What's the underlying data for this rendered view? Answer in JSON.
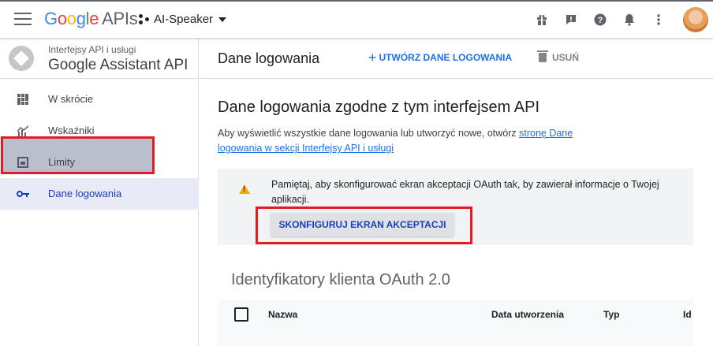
{
  "header": {
    "logo_google": [
      "G",
      "o",
      "o",
      "g",
      "l",
      "e"
    ],
    "logo_apis": "APIs",
    "project_name": "AI-Speaker",
    "icons": [
      "gift-icon",
      "feedback-icon",
      "help-icon",
      "notifications-icon",
      "more-vert-icon",
      "avatar"
    ]
  },
  "sidebar": {
    "api_subtitle": "Interfejsy API i usługi",
    "api_name": "Google Assistant API",
    "items": [
      {
        "label": "W skrócie",
        "icon": "dashboard-icon"
      },
      {
        "label": "Wskaźniki",
        "icon": "metrics-icon"
      },
      {
        "label": "Limity",
        "icon": "quotas-icon"
      },
      {
        "label": "Dane logowania",
        "icon": "key-icon",
        "active": true
      }
    ]
  },
  "action_bar": {
    "title": "Dane logowania",
    "create_label": "UTWÓRZ DANE LOGOWANIA",
    "delete_label": "USUŃ"
  },
  "content": {
    "title": "Dane logowania zgodne z tym interfejsem API",
    "desc_text": "Aby wyświetlić wszystkie dane logowania lub utworzyć nowe, otwórz ",
    "desc_link": "stronę Dane logowania w sekcji Interfejsy API i usługi",
    "notice_text": "Pamiętaj, aby skonfigurować ekran akceptacji OAuth tak, by zawierał informacje o Twojej aplikacji.",
    "configure_button": "SKONFIGURUJ EKRAN AKCEPTACJI",
    "oauth_title": "Identyfikatory klienta OAuth 2.0",
    "table_headers": [
      "Nazwa",
      "Data utworzenia",
      "Typ",
      "Id"
    ]
  },
  "colors": {
    "accent": "#1a73e8",
    "highlight": "#e31b23",
    "warning": "#f9ab00"
  }
}
